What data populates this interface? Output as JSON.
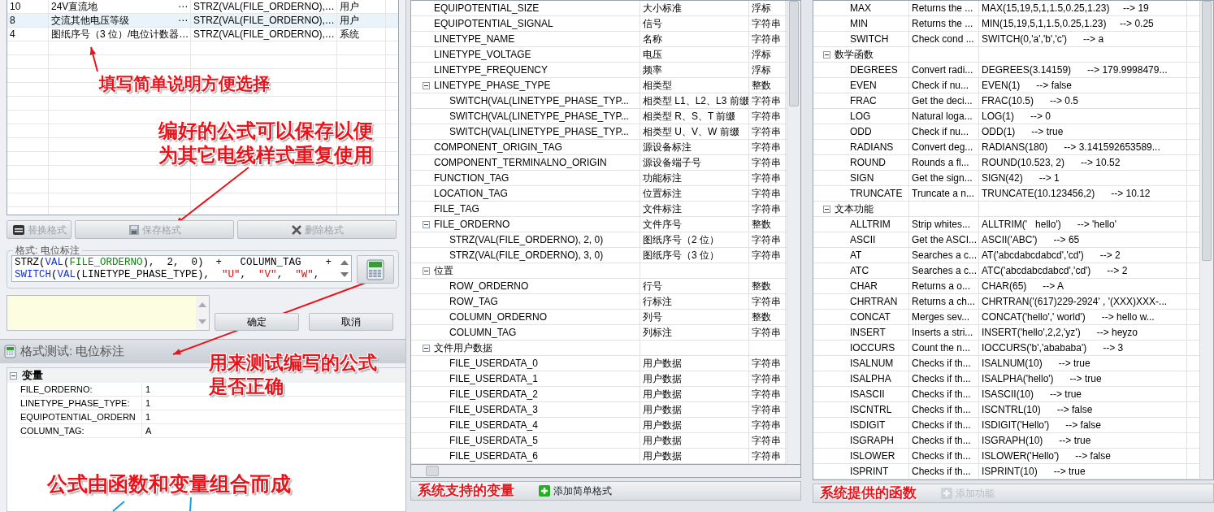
{
  "format_table": {
    "rows": [
      {
        "no": "10",
        "description": "24V直流地",
        "button": "⋯",
        "formula": "STRZ(VAL(FILE_ORDERNO),…",
        "type": "用户",
        "selected": false
      },
      {
        "no": "8",
        "description": "交流其他电压等级",
        "button": "⋯",
        "formula": "STRZ(VAL(FILE_ORDERNO),…",
        "type": "用户",
        "selected": true
      },
      {
        "no": "4",
        "description": "图纸序号（3 位）/电位计数器…",
        "formula": "STRZ(VAL(FILE_ORDERNO),…",
        "type": "系统",
        "selected": false
      }
    ]
  },
  "format_buttons": [
    {
      "label": "替换格式",
      "disabled": true
    },
    {
      "label": "保存格式",
      "disabled": true
    },
    {
      "label": "删除格式",
      "disabled": true
    }
  ],
  "formula_group": {
    "title": "格式: 电位标注",
    "lines": [
      [
        {
          "t": "STRZ(",
          "kind": "plain"
        },
        {
          "t": "VAL",
          "kind": "func"
        },
        {
          "t": "(",
          "kind": "plain"
        },
        {
          "t": "FILE_ORDERNO",
          "kind": "var"
        },
        {
          "t": "),  2,  0)  +   COLUMN_TAG    +",
          "kind": "plain"
        }
      ],
      [
        {
          "t": "SWITCH",
          "kind": "func"
        },
        {
          "t": "(",
          "kind": "plain"
        },
        {
          "t": "VAL",
          "kind": "func"
        },
        {
          "t": "(LINETYPE_PHASE_TYPE),  ",
          "kind": "plain"
        },
        {
          "t": "\"U\"",
          "kind": "str"
        },
        {
          "t": ",  ",
          "kind": "plain"
        },
        {
          "t": "\"V\"",
          "kind": "str"
        },
        {
          "t": ",  ",
          "kind": "plain"
        },
        {
          "t": "\"W\"",
          "kind": "str"
        },
        {
          "t": ",",
          "kind": "plain"
        }
      ]
    ]
  },
  "dialog_buttons": [
    "确定",
    "取消"
  ],
  "test_panel": {
    "title": "格式测试: 电位标注",
    "category": "变量",
    "expanded": true,
    "variables": [
      {
        "name": "FILE_ORDERNO:",
        "value": "1"
      },
      {
        "name": "LINETYPE_PHASE_TYPE:",
        "value": "1"
      },
      {
        "name": "EQUIPOTENTIAL_ORDERN",
        "value": "1"
      },
      {
        "name": "COLUMN_TAG:",
        "value": "A"
      }
    ]
  },
  "annotations": [
    {
      "lines": [
        "填写简单说明方便选择"
      ]
    },
    {
      "lines": [
        "编好的公式可以保存以便",
        "为其它电线样式重复使用"
      ]
    },
    {
      "lines": [
        "用来测试编写的公式",
        "是否正确"
      ]
    },
    {
      "lines": [
        "公式由函数和变量组合而成"
      ]
    }
  ],
  "variables": {
    "items": [
      {
        "name": "EQUIPOTENTIAL_SIZE",
        "description": "大小标准",
        "type": "浮标"
      },
      {
        "name": "EQUIPOTENTIAL_SIGNAL",
        "description": "信号",
        "type": "字符串"
      },
      {
        "name": "LINETYPE_NAME",
        "description": "名称",
        "type": "字符串"
      },
      {
        "name": "LINETYPE_VOLTAGE",
        "description": "电压",
        "type": "浮标"
      },
      {
        "name": "LINETYPE_FREQUENCY",
        "description": "频率",
        "type": "浮标"
      },
      {
        "name": "LINETYPE_PHASE_TYPE",
        "description": "相类型",
        "type": "整数",
        "expanded": true,
        "children": [
          {
            "name": "SWITCH(VAL(LINETYPE_PHASE_TYP...",
            "description": "相类型 L1、L2、L3 前缀",
            "type": "字符串"
          },
          {
            "name": "SWITCH(VAL(LINETYPE_PHASE_TYP...",
            "description": "相类型 R、S、T 前缀",
            "type": "字符串"
          },
          {
            "name": "SWITCH(VAL(LINETYPE_PHASE_TYP...",
            "description": "相类型 U、V、W 前缀",
            "type": "字符串"
          }
        ]
      },
      {
        "name": "COMPONENT_ORIGIN_TAG",
        "description": "源设备标注",
        "type": "字符串"
      },
      {
        "name": "COMPONENT_TERMINALNO_ORIGIN",
        "description": "源设备端子号",
        "type": "字符串"
      },
      {
        "name": "FUNCTION_TAG",
        "description": "功能标注",
        "type": "字符串"
      },
      {
        "name": "LOCATION_TAG",
        "description": "位置标注",
        "type": "字符串"
      },
      {
        "name": "FILE_TAG",
        "description": "文件标注",
        "type": "字符串"
      },
      {
        "name": "FILE_ORDERNO",
        "description": "文件序号",
        "type": "整数",
        "expanded": true,
        "children": [
          {
            "name": "STRZ(VAL(FILE_ORDERNO), 2, 0)",
            "description": "图纸序号（2 位）",
            "type": "字符串"
          },
          {
            "name": "STRZ(VAL(FILE_ORDERNO), 3, 0)",
            "description": "图纸序号（3 位）",
            "type": "字符串"
          }
        ]
      },
      {
        "name": "位置",
        "expanded": true,
        "children": [
          {
            "name": "ROW_ORDERNO",
            "description": "行号",
            "type": "整数"
          },
          {
            "name": "ROW_TAG",
            "description": "行标注",
            "type": "字符串"
          },
          {
            "name": "COLUMN_ORDERNO",
            "description": "列号",
            "type": "整数"
          },
          {
            "name": "COLUMN_TAG",
            "description": "列标注",
            "type": "字符串"
          }
        ]
      },
      {
        "name": "文件用户数据",
        "expanded": true,
        "children": [
          {
            "name": "FILE_USERDATA_0",
            "description": "用户数据",
            "type": "字符串"
          },
          {
            "name": "FILE_USERDATA_1",
            "description": "用户数据",
            "type": "字符串"
          },
          {
            "name": "FILE_USERDATA_2",
            "description": "用户数据",
            "type": "字符串"
          },
          {
            "name": "FILE_USERDATA_3",
            "description": "用户数据",
            "type": "字符串"
          },
          {
            "name": "FILE_USERDATA_4",
            "description": "用户数据",
            "type": "字符串"
          },
          {
            "name": "FILE_USERDATA_5",
            "description": "用户数据",
            "type": "字符串"
          },
          {
            "name": "FILE_USERDATA_6",
            "description": "用户数据",
            "type": "字符串"
          }
        ]
      }
    ],
    "annotation": "系统支持的变量",
    "button": {
      "label": "添加简单格式",
      "disabled": false
    }
  },
  "functions": {
    "items": [
      {
        "children": [
          {
            "name": "MAX",
            "description": "Returns the ...",
            "example": "MAX(15,19,5,1,1.5,0.25,1.23)     --> 19"
          },
          {
            "name": "MIN",
            "description": "Returns the ...",
            "example": "MIN(15,19,5,1,1.5,0.25,1.23)     --> 0.25"
          },
          {
            "name": "SWITCH",
            "description": "Check cond ...",
            "example": "SWITCH(0,'a','b','c')      --> a"
          }
        ]
      },
      {
        "name": "数学函数",
        "expanded": true,
        "children": [
          {
            "name": "DEGREES",
            "description": "Convert radi...",
            "example": "DEGREES(3.14159)      --> 179.9998479..."
          },
          {
            "name": "EVEN",
            "description": "Check if nu...",
            "example": "EVEN(1)      --> false"
          },
          {
            "name": "FRAC",
            "description": "Get the deci...",
            "example": "FRAC(10.5)      --> 0.5"
          },
          {
            "name": "LOG",
            "description": "Natural loga...",
            "example": "LOG(1)      --> 0"
          },
          {
            "name": "ODD",
            "description": "Check if nu...",
            "example": "ODD(1)      --> true"
          },
          {
            "name": "RADIANS",
            "description": "Convert deg...",
            "example": "RADIANS(180)      --> 3.141592653589..."
          },
          {
            "name": "ROUND",
            "description": "Rounds a fl...",
            "example": "ROUND(10.523, 2)      --> 10.52"
          },
          {
            "name": "SIGN",
            "description": "Get the sign...",
            "example": "SIGN(42)      --> 1"
          },
          {
            "name": "TRUNCATE",
            "description": "Truncate a n...",
            "example": "TRUNCATE(10.123456,2)      --> 10.12"
          }
        ]
      },
      {
        "name": "文本功能",
        "expanded": true,
        "children": [
          {
            "name": "ALLTRIM",
            "description": "Strip whites...",
            "example": "ALLTRIM('   hello')      --> 'hello'"
          },
          {
            "name": "ASCII",
            "description": "Get the ASCI...",
            "example": "ASCII('ABC')      --> 65"
          },
          {
            "name": "AT",
            "description": "Searches a c...",
            "example": "AT('abcdabcdabcd','cd')      --> 2"
          },
          {
            "name": "ATC",
            "description": "Searches a c...",
            "example": "ATC('abcdabcdabcd','cd')      --> 2"
          },
          {
            "name": "CHAR",
            "description": "Returns a o...",
            "example": "CHAR(65)      --> A"
          },
          {
            "name": "CHRTRAN",
            "description": "Returns a ch...",
            "example": "CHRTRAN('(617)229-2924' , '(XXX)XXX-..."
          },
          {
            "name": "CONCAT",
            "description": "Merges sev...",
            "example": "CONCAT('hello',' world')      --> hello w..."
          },
          {
            "name": "INSERT",
            "description": "Inserts a stri...",
            "example": "INSERT('hello',2,2,'yz')      --> heyzo"
          },
          {
            "name": "IOCCURS",
            "description": "Count the n...",
            "example": "IOCCURS('b','abababa')      --> 3"
          },
          {
            "name": "ISALNUM",
            "description": "Checks if th...",
            "example": "ISALNUM(10)      --> true"
          },
          {
            "name": "ISALPHA",
            "description": "Checks if th...",
            "example": "ISALPHA('hello')      --> true"
          },
          {
            "name": "ISASCII",
            "description": "Checks if th...",
            "example": "ISASCII(10)      --> true"
          },
          {
            "name": "ISCNTRL",
            "description": "Checks if th...",
            "example": "ISCNTRL(10)      --> false"
          },
          {
            "name": "ISDIGIT",
            "description": "Checks if th...",
            "example": "ISDIGIT('Hello')      --> false"
          },
          {
            "name": "ISGRAPH",
            "description": "Checks if th...",
            "example": "ISGRAPH(10)      --> true"
          },
          {
            "name": "ISLOWER",
            "description": "Checks if th...",
            "example": "ISLOWER('Hello')      --> false"
          },
          {
            "name": "ISPRINT",
            "description": "Checks if th...",
            "example": "ISPRINT(10)      --> true"
          }
        ]
      }
    ],
    "annotation": "系统提供的函数",
    "button": {
      "label": "添加功能",
      "disabled": true
    }
  }
}
